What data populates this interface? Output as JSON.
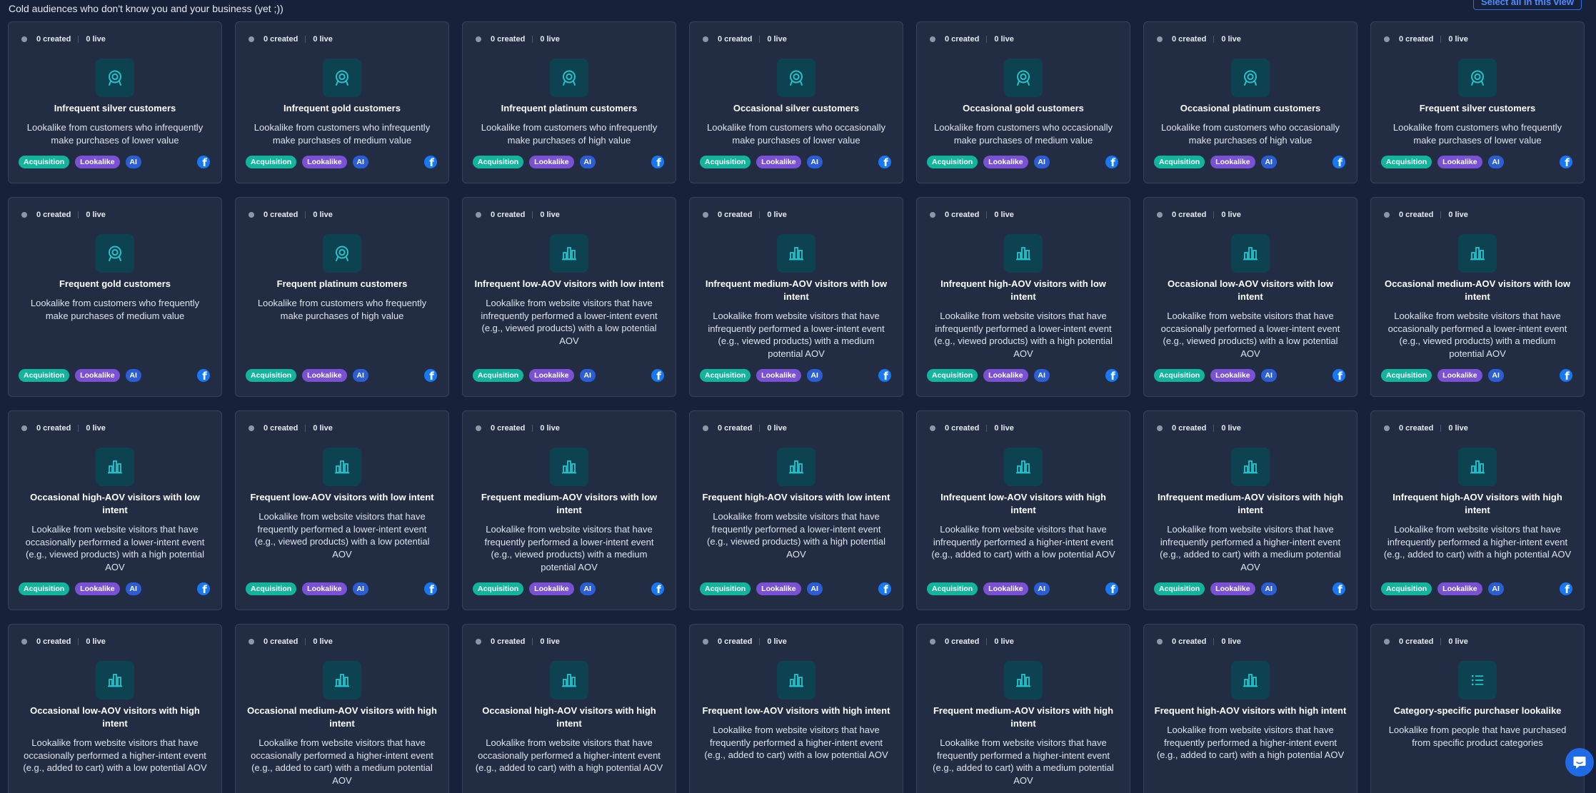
{
  "header": {
    "title": "Cold audiences who don't know you and your business (yet ;))",
    "select_all_label": "Select all in this view"
  },
  "tags": {
    "acquisition": "Acquisition",
    "lookalike": "Lookalike",
    "ai": "AI"
  },
  "colors": {
    "background": "#18213a",
    "card": "#222d43",
    "acquisition": "#12b59c",
    "lookalike": "#7a50d4",
    "ai": "#2b5ed6",
    "facebook": "#1877f2",
    "icon_bg": "#0d4250",
    "icon_fg": "#24c3cc"
  },
  "cards": [
    {
      "created": "0 created",
      "live": "0 live",
      "icon": "target-icon",
      "title": "Infrequent silver customers",
      "description": "Lookalike from customers who infrequently make purchases of lower value"
    },
    {
      "created": "0 created",
      "live": "0 live",
      "icon": "target-icon",
      "title": "Infrequent gold customers",
      "description": "Lookalike from customers who infrequently make purchases of medium value"
    },
    {
      "created": "0 created",
      "live": "0 live",
      "icon": "target-icon",
      "title": "Infrequent platinum customers",
      "description": "Lookalike from customers who infrequently make purchases of high value"
    },
    {
      "created": "0 created",
      "live": "0 live",
      "icon": "target-icon",
      "title": "Occasional silver customers",
      "description": "Lookalike from customers who occasionally make purchases of lower value"
    },
    {
      "created": "0 created",
      "live": "0 live",
      "icon": "target-icon",
      "title": "Occasional gold customers",
      "description": "Lookalike from customers who occasionally make purchases of medium value"
    },
    {
      "created": "0 created",
      "live": "0 live",
      "icon": "target-icon",
      "title": "Occasional platinum customers",
      "description": "Lookalike from customers who occasionally make purchases of high value"
    },
    {
      "created": "0 created",
      "live": "0 live",
      "icon": "target-icon",
      "title": "Frequent silver customers",
      "description": "Lookalike from customers who frequently make purchases of lower value"
    },
    {
      "created": "0 created",
      "live": "0 live",
      "icon": "target-icon",
      "title": "Frequent gold customers",
      "description": "Lookalike from customers who frequently make purchases of medium value"
    },
    {
      "created": "0 created",
      "live": "0 live",
      "icon": "target-icon",
      "title": "Frequent platinum customers",
      "description": "Lookalike from customers who frequently make purchases of high value"
    },
    {
      "created": "0 created",
      "live": "0 live",
      "icon": "bar-chart-icon",
      "title": "Infrequent low-AOV visitors with low intent",
      "description": "Lookalike from website visitors that have infrequently performed a lower-intent event (e.g., viewed products) with a low potential AOV"
    },
    {
      "created": "0 created",
      "live": "0 live",
      "icon": "bar-chart-icon",
      "title": "Infrequent medium-AOV visitors with low intent",
      "description": "Lookalike from website visitors that have infrequently performed a lower-intent event (e.g., viewed products) with a medium potential AOV"
    },
    {
      "created": "0 created",
      "live": "0 live",
      "icon": "bar-chart-icon",
      "title": "Infrequent high-AOV visitors with low intent",
      "description": "Lookalike from website visitors that have infrequently performed a lower-intent event (e.g., viewed products) with a high potential AOV"
    },
    {
      "created": "0 created",
      "live": "0 live",
      "icon": "bar-chart-icon",
      "title": "Occasional low-AOV visitors with low intent",
      "description": "Lookalike from website visitors that have occasionally performed a lower-intent event (e.g., viewed products) with a low potential AOV"
    },
    {
      "created": "0 created",
      "live": "0 live",
      "icon": "bar-chart-icon",
      "title": "Occasional medium-AOV visitors with low intent",
      "description": "Lookalike from website visitors that have occasionally performed a lower-intent event (e.g., viewed products) with a medium potential AOV"
    },
    {
      "created": "0 created",
      "live": "0 live",
      "icon": "bar-chart-icon",
      "title": "Occasional high-AOV visitors with low intent",
      "description": "Lookalike from website visitors that have occasionally performed a lower-intent event (e.g., viewed products) with a high potential AOV"
    },
    {
      "created": "0 created",
      "live": "0 live",
      "icon": "bar-chart-icon",
      "title": "Frequent low-AOV visitors with low intent",
      "description": "Lookalike from website visitors that have frequently performed a lower-intent event (e.g., viewed products) with a low potential AOV"
    },
    {
      "created": "0 created",
      "live": "0 live",
      "icon": "bar-chart-icon",
      "title": "Frequent medium-AOV visitors with low intent",
      "description": "Lookalike from website visitors that have frequently performed a lower-intent event (e.g., viewed products) with a medium potential AOV"
    },
    {
      "created": "0 created",
      "live": "0 live",
      "icon": "bar-chart-icon",
      "title": "Frequent high-AOV visitors with low intent",
      "description": "Lookalike from website visitors that have frequently performed a lower-intent event (e.g., viewed products) with a high potential AOV"
    },
    {
      "created": "0 created",
      "live": "0 live",
      "icon": "bar-chart-icon",
      "title": "Infrequent low-AOV visitors with high intent",
      "description": "Lookalike from website visitors that have infrequently performed a higher-intent event (e.g., added to cart) with a low potential AOV"
    },
    {
      "created": "0 created",
      "live": "0 live",
      "icon": "bar-chart-icon",
      "title": "Infrequent medium-AOV visitors with high intent",
      "description": "Lookalike from website visitors that have infrequently performed a higher-intent event (e.g., added to cart) with a medium potential AOV"
    },
    {
      "created": "0 created",
      "live": "0 live",
      "icon": "bar-chart-icon",
      "title": "Infrequent high-AOV visitors with high intent",
      "description": "Lookalike from website visitors that have infrequently performed a higher-intent event (e.g., added to cart) with a high potential AOV"
    },
    {
      "created": "0 created",
      "live": "0 live",
      "icon": "bar-chart-icon",
      "title": "Occasional low-AOV visitors with high intent",
      "description": "Lookalike from website visitors that have occasionally performed a higher-intent event (e.g., added to cart) with a low potential AOV"
    },
    {
      "created": "0 created",
      "live": "0 live",
      "icon": "bar-chart-icon",
      "title": "Occasional medium-AOV visitors with high intent",
      "description": "Lookalike from website visitors that have occasionally performed a higher-intent event (e.g., added to cart) with a medium potential AOV"
    },
    {
      "created": "0 created",
      "live": "0 live",
      "icon": "bar-chart-icon",
      "title": "Occasional high-AOV visitors with high intent",
      "description": "Lookalike from website visitors that have occasionally performed a higher-intent event (e.g., added to cart) with a high potential AOV"
    },
    {
      "created": "0 created",
      "live": "0 live",
      "icon": "bar-chart-icon",
      "title": "Frequent low-AOV visitors with high intent",
      "description": "Lookalike from website visitors that have frequently performed a higher-intent event (e.g., added to cart) with a low potential AOV"
    },
    {
      "created": "0 created",
      "live": "0 live",
      "icon": "bar-chart-icon",
      "title": "Frequent medium-AOV visitors with high intent",
      "description": "Lookalike from website visitors that have frequently performed a higher-intent event (e.g., added to cart) with a medium potential AOV"
    },
    {
      "created": "0 created",
      "live": "0 live",
      "icon": "bar-chart-icon",
      "title": "Frequent high-AOV visitors with high intent",
      "description": "Lookalike from website visitors that have frequently performed a higher-intent event (e.g., added to cart) with a high potential AOV"
    },
    {
      "created": "0 created",
      "live": "0 live",
      "icon": "list-icon",
      "title": "Category-specific purchaser lookalike",
      "description": "Lookalike from people that have purchased from specific product categories"
    }
  ]
}
